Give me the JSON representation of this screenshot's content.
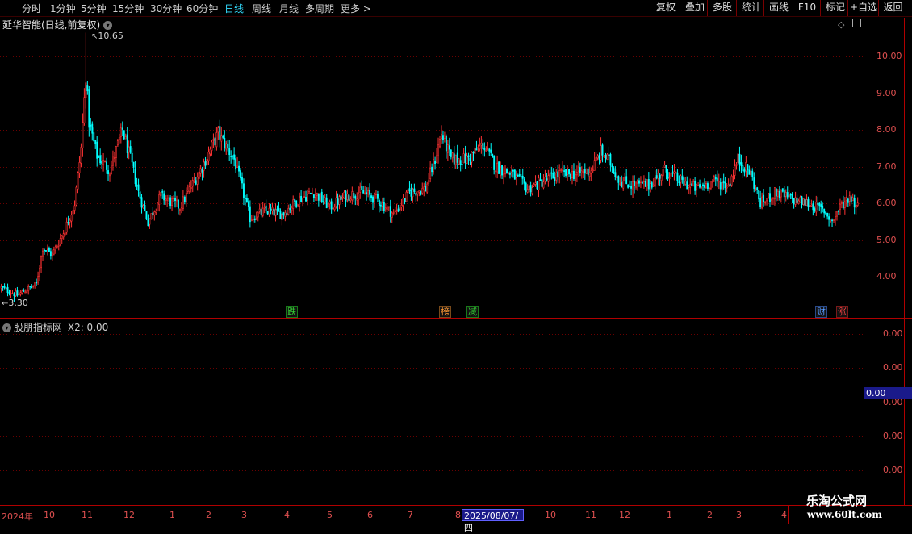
{
  "periods": [
    "分时",
    "1分钟",
    "5分钟",
    "15分钟",
    "30分钟",
    "60分钟",
    "日线",
    "周线",
    "月线",
    "多周期",
    "更多 >"
  ],
  "active_period": "日线",
  "tools": [
    "复权",
    "叠加",
    "多股",
    "统计",
    "画线",
    "F10",
    "标记",
    "+自选",
    "返回"
  ],
  "stock_title": "延华智能(日线,前复权)",
  "price_axis": [
    "10.00",
    "9.00",
    "8.00",
    "7.00",
    "6.00",
    "5.00",
    "4.00"
  ],
  "high_label": "10.65",
  "low_label": "3.30",
  "markers": [
    {
      "text": "跌",
      "color": "#33cc33",
      "border": "#1a7a1a"
    },
    {
      "text": "榜",
      "color": "#ff9933",
      "border": "#7a4a1a"
    },
    {
      "text": "减",
      "color": "#33cc33",
      "border": "#1a7a1a"
    },
    {
      "text": "财",
      "color": "#5599ff",
      "border": "#2a4a8a"
    },
    {
      "text": "涨",
      "color": "#ff4444",
      "border": "#7a1a1a"
    }
  ],
  "indicator": {
    "name": "股朋指标网",
    "value_label": "X2: 0.00"
  },
  "indicator_axis": [
    "0.00",
    "0.00",
    "0.00",
    "0.00",
    "0.00"
  ],
  "current_value": "0.00",
  "x_axis": [
    "2024年",
    "10",
    "11",
    "12",
    "1",
    "2",
    "3",
    "4",
    "5",
    "6",
    "7",
    "8",
    "10",
    "11",
    "12",
    "1",
    "2",
    "3",
    "4"
  ],
  "cursor_date": "2025/08/07/四",
  "watermark": {
    "name": "乐淘公式网",
    "url": "www.60lt.com"
  },
  "chart_data": {
    "type": "candlestick",
    "title": "延华智能(日线,前复权)",
    "ylim": [
      3.0,
      11.0
    ],
    "y_ticks": [
      4,
      5,
      6,
      7,
      8,
      9,
      10
    ],
    "max_price": 10.65,
    "min_price": 3.3,
    "up_color": "#ff3333",
    "down_color": "#00ffff",
    "keypoints": [
      [
        0,
        3.7
      ],
      [
        10,
        3.5
      ],
      [
        22,
        3.8
      ],
      [
        26,
        4.8
      ],
      [
        32,
        4.6
      ],
      [
        40,
        5.3
      ],
      [
        46,
        6.0
      ],
      [
        50,
        7.5
      ],
      [
        53,
        9.5
      ],
      [
        55,
        8.2
      ],
      [
        60,
        7.3
      ],
      [
        68,
        6.9
      ],
      [
        76,
        8.0
      ],
      [
        81,
        7.2
      ],
      [
        86,
        6.3
      ],
      [
        92,
        5.5
      ],
      [
        100,
        6.2
      ],
      [
        112,
        5.9
      ],
      [
        126,
        7.0
      ],
      [
        136,
        7.9
      ],
      [
        146,
        7.2
      ],
      [
        156,
        5.6
      ],
      [
        166,
        5.8
      ],
      [
        176,
        5.7
      ],
      [
        186,
        6.1
      ],
      [
        196,
        6.3
      ],
      [
        206,
        5.9
      ],
      [
        216,
        6.2
      ],
      [
        226,
        6.3
      ],
      [
        236,
        6.1
      ],
      [
        246,
        5.7
      ],
      [
        256,
        6.3
      ],
      [
        266,
        6.4
      ],
      [
        272,
        7.2
      ],
      [
        276,
        7.9
      ],
      [
        282,
        7.2
      ],
      [
        292,
        7.2
      ],
      [
        302,
        7.6
      ],
      [
        310,
        7.0
      ],
      [
        320,
        6.8
      ],
      [
        330,
        6.4
      ],
      [
        340,
        6.6
      ],
      [
        350,
        6.8
      ],
      [
        360,
        6.8
      ],
      [
        370,
        6.9
      ],
      [
        376,
        7.4
      ],
      [
        382,
        7.1
      ],
      [
        388,
        6.6
      ],
      [
        396,
        6.5
      ],
      [
        406,
        6.5
      ],
      [
        416,
        6.9
      ],
      [
        426,
        6.6
      ],
      [
        436,
        6.4
      ],
      [
        446,
        6.6
      ],
      [
        456,
        6.5
      ],
      [
        462,
        7.2
      ],
      [
        470,
        6.8
      ],
      [
        476,
        6.0
      ],
      [
        486,
        6.3
      ],
      [
        496,
        6.1
      ],
      [
        506,
        6.0
      ],
      [
        516,
        5.8
      ],
      [
        521,
        5.5
      ],
      [
        526,
        5.9
      ],
      [
        532,
        6.2
      ],
      [
        537,
        5.9
      ]
    ],
    "indicator_series": {
      "name": "X2",
      "values": [
        0.0
      ],
      "ylim": [
        0,
        0
      ]
    }
  }
}
